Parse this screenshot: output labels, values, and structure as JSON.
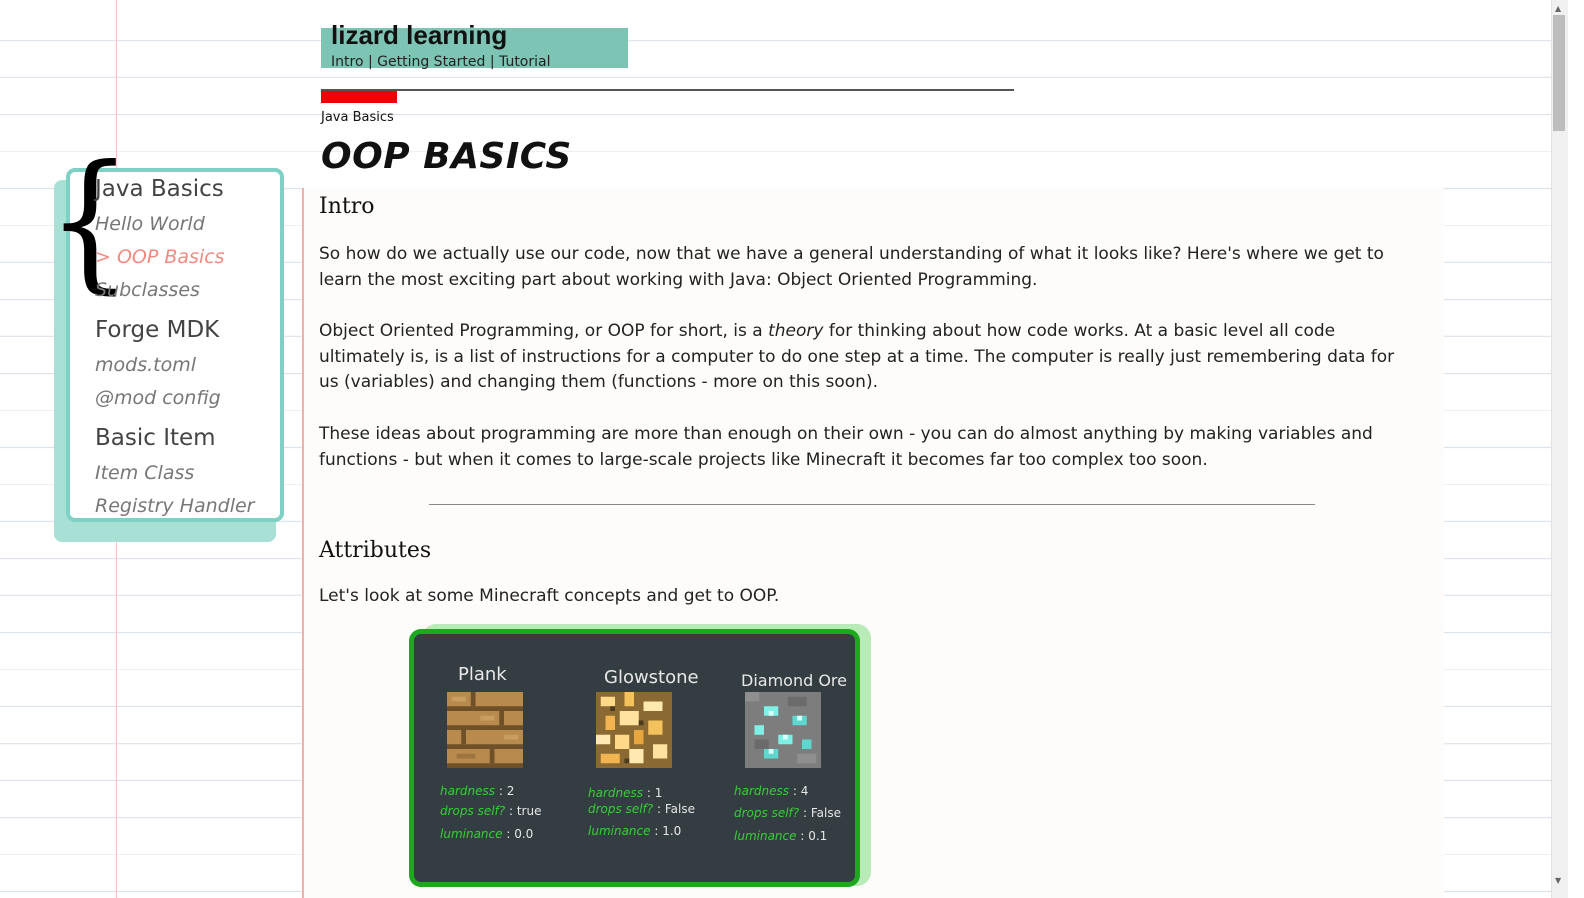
{
  "header": {
    "site_title": "lizard learning",
    "nav": [
      "Intro",
      "Getting Started",
      "Tutorial"
    ],
    "nav_separator": "|",
    "breadcrumb": "Java Basics",
    "progress": 0.11
  },
  "page_title": "OOP BASICS",
  "sidebar": {
    "groups": [
      {
        "label": "Java Basics",
        "items": [
          {
            "label": "Hello World"
          },
          {
            "label": "> OOP Basics",
            "active": true
          },
          {
            "label": "Subclasses"
          }
        ]
      },
      {
        "label": "Forge MDK",
        "items": [
          {
            "label": "mods.toml"
          },
          {
            "label": "@mod config"
          }
        ]
      },
      {
        "label": "Basic Item",
        "items": [
          {
            "label": "Item Class"
          },
          {
            "label": "Registry Handler"
          }
        ]
      }
    ]
  },
  "sections": {
    "intro": {
      "heading": "Intro",
      "p1": "So how do we actually use our code, now that we have a general understanding of what it looks like? Here's where we get to learn the most exciting part about working with Java: Object Oriented Programming.",
      "p2_before": "Object Oriented Programming, or OOP for short, is a ",
      "p2_em": "theory",
      "p2_after": " for thinking about how code works. At a basic level all code ultimately is, is a list of instructions for a computer to do one step at a time. The computer is really just remembering data for us (variables) and changing them (functions - more on this soon).",
      "p3": "These ideas about programming are more than enough on their own - you can do almost anything by making variables and functions - but when it comes to large-scale projects like Minecraft it becomes far too complex too soon."
    },
    "attributes": {
      "heading": "Attributes",
      "p1": "Let's look at some Minecraft concepts and get to OOP."
    }
  },
  "figure": {
    "blocks": [
      {
        "name": "Plank",
        "hardness": "2",
        "drops_self": "true",
        "luminance": "0.0"
      },
      {
        "name": "Glowstone",
        "hardness": "1",
        "drops_self": "False",
        "luminance": "1.0"
      },
      {
        "name": "Diamond Ore",
        "hardness": "4",
        "drops_self": "False",
        "luminance": "0.1"
      }
    ],
    "labels": {
      "hardness": "hardness",
      "drops_self": "drops self?",
      "luminance": "luminance",
      "sep": ":"
    }
  },
  "colors": {
    "header_bg": "#7ec4b5",
    "sidebar_border": "#7ed1c4",
    "active_link": "#f08a80",
    "progress": "#ee0000",
    "figure_border": "#1ea81e",
    "stat_label": "#33d133"
  }
}
